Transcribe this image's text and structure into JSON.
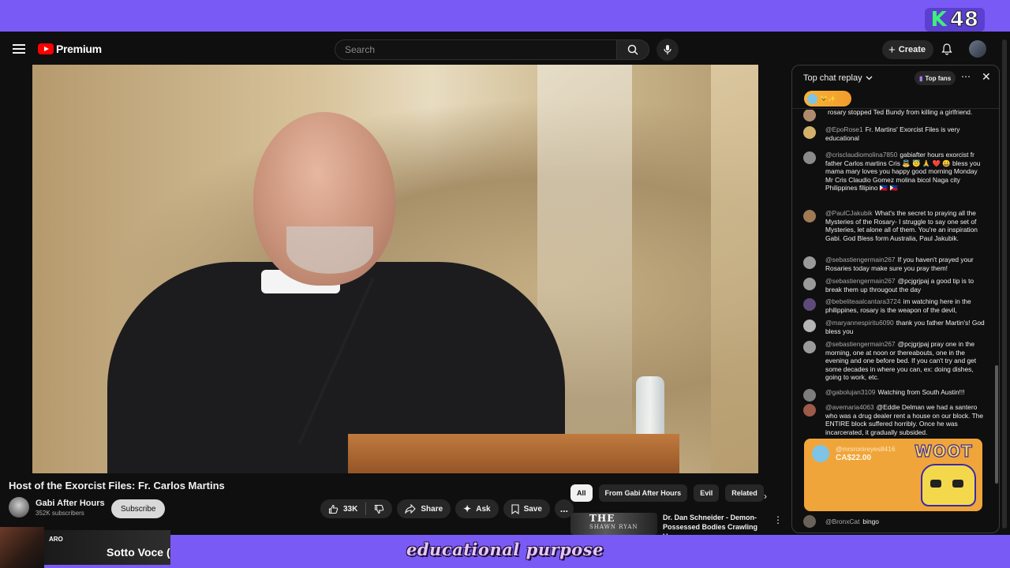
{
  "stream_overlay": {
    "badge_letter": "K",
    "badge_number": "48",
    "caption": "educational purpose",
    "now_playing_tag": "ARO",
    "now_playing": "Sotto Voce ("
  },
  "masthead": {
    "logo": "Premium",
    "search_placeholder": "Search",
    "create_label": "Create"
  },
  "video": {
    "title": "Host of the Exorcist Files: Fr. Carlos Martins",
    "channel": "Gabi After Hours",
    "subscribers": "352K subscribers",
    "subscribe_label": "Subscribe",
    "like_count": "33K",
    "share_label": "Share",
    "ask_label": "Ask",
    "save_label": "Save",
    "more_label": "..."
  },
  "related": {
    "chips": [
      "All",
      "From Gabi After Hours",
      "Evil",
      "Related"
    ],
    "active_chip": "All",
    "item": {
      "thumb_title": "THE",
      "thumb_subtitle": "SHAWN RYAN",
      "title": "Dr. Dan Schneider - Demon-Possessed Bodies Crawling U..."
    }
  },
  "chat": {
    "mode": "Top chat replay",
    "top_fans_label": "Top fans",
    "messages": [
      {
        "author": "",
        "text": "rosary stopped Ted Bundy from killing a girlfriend.",
        "color": "#b08a6e"
      },
      {
        "author": "@EpoRose1",
        "text": "Fr. Martins' Exorcist Files is very educational",
        "color": "#d4b06a"
      },
      {
        "author": "@crisclaudiomolina7850",
        "text": "gabiafter hours exorcist fr father Carlos martins Cris 👼 😇 🙏 ❤️ 😀 bless you mama mary loves you happy good morning Monday Mr Cris Claudio Gomez molina bicol Naga city Philippines filipino 🇵🇭 🇵🇭",
        "color": "#8a8a8a"
      },
      {
        "author": "@PaulCJakubik",
        "text": "What's the secret to praying all the Mysteries of the Rosary- I struggle to say one set of Mysteries, let alone all of them. You're an inspiration Gabi. God Bless form Australia, Paul Jakubik.",
        "color": "#a07a55"
      },
      {
        "author": "@sebastiengermain267",
        "text": "If you haven't prayed your Rosaries today make sure you pray them!",
        "color": "#9a9a9a"
      },
      {
        "author": "@sebastiengermain267",
        "text": "@pcjgrjpaj a good tip is to break them up througout the day",
        "color": "#9a9a9a"
      },
      {
        "author": "@bebeliteaalcantara3724",
        "text": "im watching here in the philippines, rosary is the weapon of the devil,",
        "color": "#5c4a7a"
      },
      {
        "author": "@maryannespiritu6090",
        "text": "thank you father Martin's! God bless you",
        "color": "#b5b5b5"
      },
      {
        "author": "@sebastiengermain267",
        "text": "@pcjgrjpaj pray one in the morning, one at noon or thereabouts, one in the evening and one before bed. If you can't try and get some decades in where you can, ex: doing dishes, going to work, etc.",
        "color": "#9a9a9a"
      },
      {
        "author": "@gabolujan3109",
        "text": "Watching from South Austin!!!",
        "color": "#7d7d7d"
      },
      {
        "author": "@avemaria4063",
        "text": "@Eddie Delman we had a santero who was a drug dealer rent a house on our block. The ENTIRE block suffered horribly. Once he was incarcerated, it gradually subsided.",
        "color": "#9c5a48"
      }
    ],
    "superchat": {
      "author": "@mrsronireyes8416",
      "amount": "CA$22.00",
      "sticker_text": "WOOT"
    },
    "last_message": {
      "author": "@BronxCat",
      "text": "bingo"
    }
  }
}
